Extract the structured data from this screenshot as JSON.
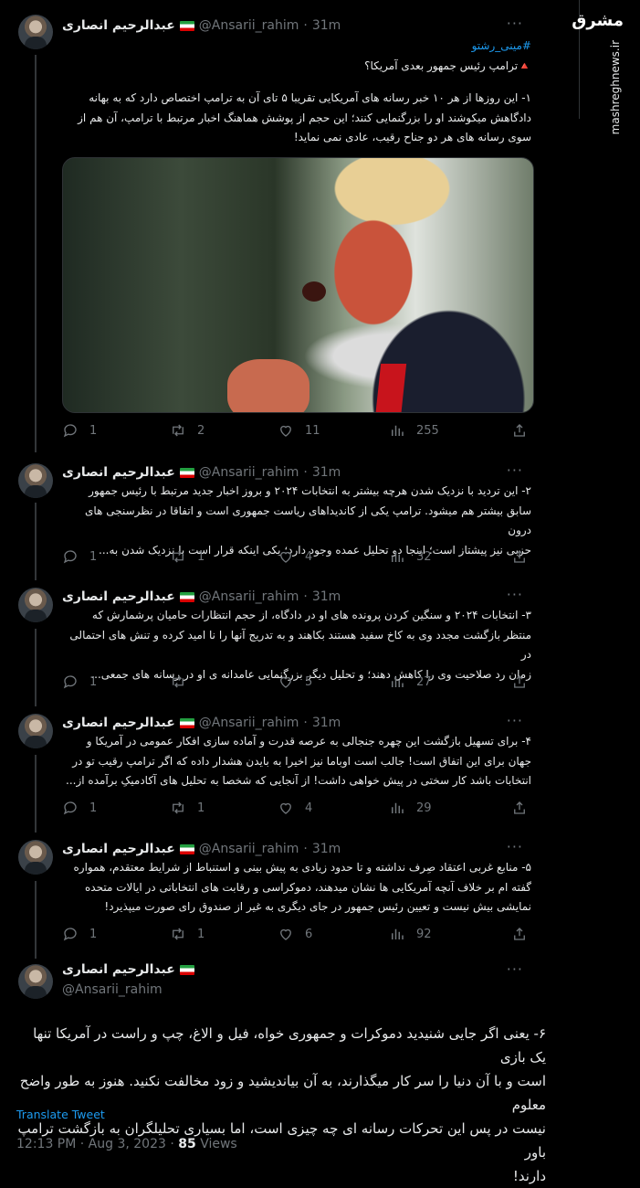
{
  "sidebar": {
    "logo_text": "مشرق",
    "site": "mashreghnews.ir"
  },
  "author": {
    "name": "عبدالرحیم انصاری",
    "handle": "@Ansarii_rahim"
  },
  "tweets": [
    {
      "time": "31m",
      "lines": [
        "#مینی_رشتو",
        "🔺ترامپ رئیس جمهور بعدی آمریکا؟",
        "",
        "۱- این روزها از هر ۱۰ خبر رسانه های آمریکایی تقریبا ۵ تای آن به ترامپ اختصاص دارد که به بهانه",
        "دادگاهش میکوشند او را بزرگنمایی کنند؛ این حجم از پوشش هماهنگ اخبار مرتبط با ترامپ، آن هم از",
        "سوی رسانه های هر دو جناح رقیب، عادی نمی نماید!"
      ],
      "replies": "1",
      "retweets": "2",
      "likes": "11",
      "views": "255"
    },
    {
      "time": "31m",
      "lines": [
        "۲- این تردید با نزدیک شدن هرچه بیشتر به انتخابات ۲۰۲۴ و بروز اخبار جدید مرتبط با رئیس جمهور",
        "سابق بیشتر هم میشود. ترامپ یکی از کاندیداهای ریاست جمهوری است و اتفاقا در نظرسنجی های درون",
        "حزبی نیز پیشتاز است؛ اینجا دو تحلیل عمده وجود دارد؛ یکی اینکه قرار است با نزدیک شدن به..."
      ],
      "replies": "1",
      "retweets": "1",
      "likes": "4",
      "views": "32"
    },
    {
      "time": "31m",
      "lines": [
        "۳- انتخابات ۲۰۲۴ و سنگین کردن پرونده های او در دادگاه، از حجم انتظارات حامیان پرشمارش که",
        "منتظر بازگشت مجدد وی به کاخ سفید هستند بکاهند و به تدریج آنها را نا امید کرده و تنش های احتمالی در",
        "زمان رد صلاحیت وی را کاهش دهند؛ و تحلیل دیگر بزرگنمایی عامدانه ی او در رسانه های جمعی..."
      ],
      "replies": "1",
      "retweets": "",
      "likes": "5",
      "views": "27"
    },
    {
      "time": "31m",
      "lines": [
        "۴- برای تسهیل بازگشت این چهره جنجالی به عرصه قدرت و آماده سازی افکار عمومی در آمریکا و",
        "جهان برای این اتفاق است! جالب است اوباما نیز اخیرا به بایدن هشدار داده که اگر ترامپ رقیب تو در",
        "انتخابات باشد کار سختی در پیش خواهی داشت! از آنجایی که شخصا به تحلیل های آکادمیکِ برآمده از..."
      ],
      "replies": "1",
      "retweets": "1",
      "likes": "4",
      "views": "29"
    },
    {
      "time": "31m",
      "lines": [
        "۵- منابع غربی اعتقاد صِرف نداشته و تا حدود زیادی به پیش بینی و استنباط از شرایط معتقدم، همواره",
        "گفته ام بر خلاف آنچه آمریکایی ها نشان میدهند، دموکراسی و رقابت های انتخاباتی در ایالات متحده",
        "نمایشی بیش نیست و تعیین رئیس جمهور در جای دیگری به غیر از صندوق رای صورت میپذیرد!"
      ],
      "replies": "1",
      "retweets": "1",
      "likes": "6",
      "views": "92"
    }
  ],
  "main": {
    "lines": [
      "۶- یعنی اگر جایی شنیدید دموکرات و جمهوری خواه، فیل و الاغ، چپ و راست در آمریکا تنها یک بازی",
      "است و با آن دنیا را سر کار میگذارند، به آن بیاندیشید و زود مخالفت نکنید. هنوز به طور واضح معلوم",
      "نیست در پس این تحرکات رسانه ای چه چیزی است، اما بسیاری تحلیلگران به بازگشت ترامپ باور",
      "دارند!"
    ],
    "translate_label": "Translate Tweet",
    "timestamp": "12:13 PM · Aug 3, 2023 ·",
    "views_count": "85",
    "views_label": "Views"
  },
  "more_label": "···",
  "colors": {
    "accent": "#1d9bf0",
    "muted": "#71767b",
    "background": "#000000"
  }
}
